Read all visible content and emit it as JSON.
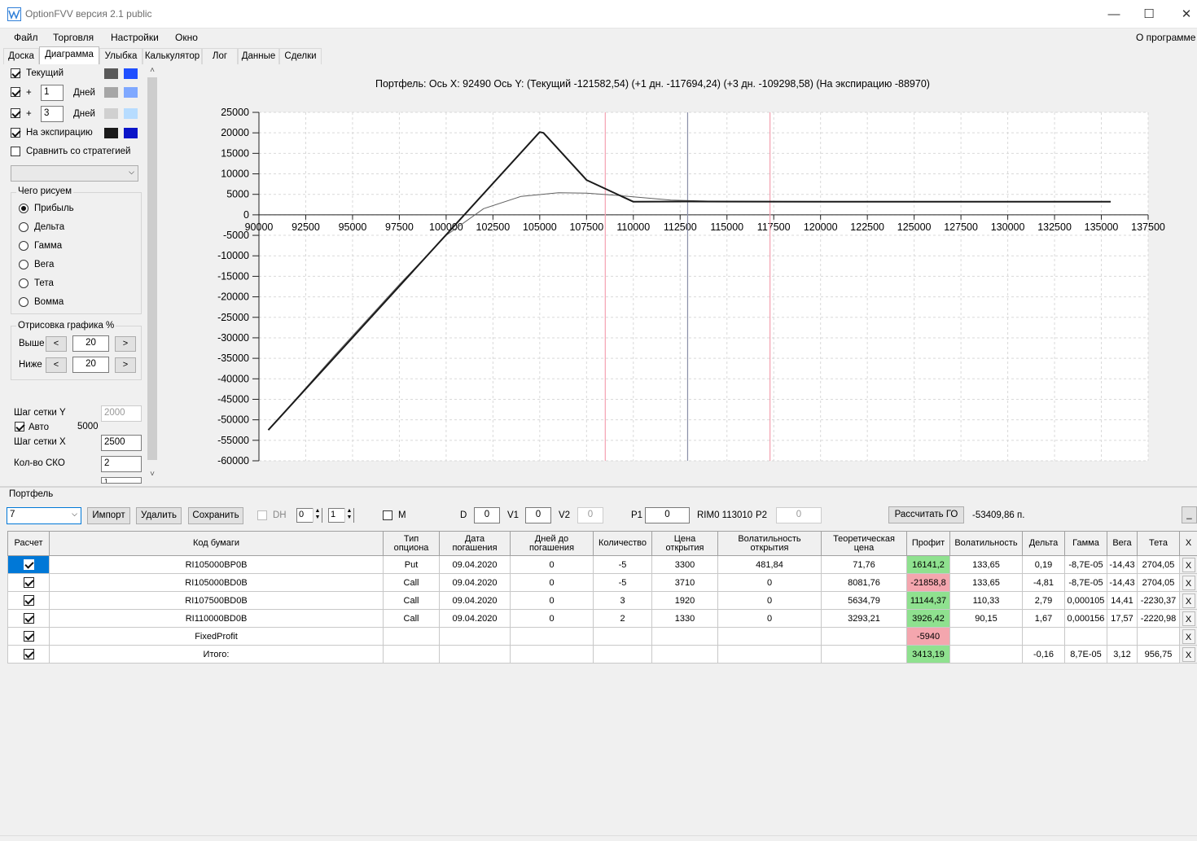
{
  "window": {
    "title": "OptionFVV версия 2.1 public",
    "min_label": "—",
    "max_label": "☐",
    "close_label": "✕"
  },
  "menu": {
    "items": [
      "Файл",
      "Торговля",
      "Настройки",
      "Окно"
    ],
    "about": "О программе"
  },
  "tabs": [
    "Доска",
    "Диаграмма",
    "Улыбка",
    "Калькулятор",
    "Лог",
    "Данные",
    "Сделки"
  ],
  "active_tab": "Диаграмма",
  "left": {
    "current_label": "Текущий",
    "plus_label": "+",
    "days_label": "Дней",
    "days1": "1",
    "days2": "3",
    "expiration_label": "На экспирацию",
    "compare_label": "Сравнить со стратегией",
    "strategy_select": "",
    "what_group": "Чего рисуем",
    "options": [
      "Прибыль",
      "Дельта",
      "Гамма",
      "Вега",
      "Тета",
      "Вомма"
    ],
    "draw_group": "Отрисовка графика %",
    "above_label": "Выше",
    "below_label": "Ниже",
    "above_value": "20",
    "below_value": "20",
    "lt": "<",
    "gt": ">",
    "grid_y_label": "Шаг сетки Y",
    "grid_y_value": "2000",
    "auto_label": "Авто",
    "auto_value": "5000",
    "grid_x_label": "Шаг сетки X",
    "grid_x_value": "2500",
    "sko_label": "Кол-во СКО",
    "sko_value": "2",
    "next_value": "1",
    "colors": {
      "current_a": "#595959",
      "current_b": "#1f4fff",
      "d1_a": "#a6a6a6",
      "d1_b": "#7fa8ff",
      "d3_a": "#d0d0d0",
      "d3_b": "#b7dcff",
      "exp_a": "#1a1a1a",
      "exp_b": "#0a14c8"
    }
  },
  "chart_header": "Портфель:  Ось  X:  92490  Ось  Y:   (Текущий  -121582,54)   (+1  дн.  -117694,24)   (+3  дн.  -109298,58)   (На  экспирацию  -88970)",
  "chart_data": {
    "type": "line",
    "xlim": [
      90000,
      137500
    ],
    "ylim": [
      -60000,
      25000
    ],
    "x_ticks": [
      90000,
      92500,
      95000,
      97500,
      100000,
      102500,
      105000,
      107500,
      110000,
      112500,
      115000,
      117500,
      120000,
      122500,
      125000,
      127500,
      130000,
      132500,
      135000,
      137500
    ],
    "y_ticks": [
      25000,
      20000,
      15000,
      10000,
      5000,
      0,
      -5000,
      -10000,
      -15000,
      -20000,
      -25000,
      -30000,
      -35000,
      -40000,
      -45000,
      -50000,
      -55000,
      -60000
    ],
    "grid": true,
    "vlines": [
      {
        "x": 108500,
        "color": "#f4a0b0"
      },
      {
        "x": 112900,
        "color": "#8a8fa8"
      },
      {
        "x": 117300,
        "color": "#f4a0b0"
      }
    ],
    "series": [
      {
        "color": "#1a1a1a",
        "width": 2,
        "x": [
          90500,
          105000,
          105200,
          107500,
          110000,
          113000,
          120000,
          135500
        ],
        "y": [
          -52500,
          20200,
          20000,
          8500,
          3200,
          3250,
          3200,
          3200
        ]
      },
      {
        "color": "#606060",
        "width": 1,
        "x": [
          90500,
          94000,
          97500,
          100000,
          102000,
          104000,
          106000,
          107500,
          109000,
          110500,
          112000,
          114000,
          118000,
          125000,
          135500
        ],
        "y": [
          -52500,
          -34500,
          -17000,
          -5000,
          1500,
          4500,
          5400,
          5300,
          4800,
          4200,
          3600,
          3350,
          3250,
          3200,
          3200
        ]
      }
    ]
  },
  "portfolio": {
    "label": "Портфель",
    "selector": "7",
    "import": "Импорт",
    "delete": "Удалить",
    "save": "Сохранить",
    "dh_label": "DH",
    "spin1": "0",
    "spin2": "1",
    "m_label": "M",
    "d_label": "D",
    "d_value": "0",
    "v1_label": "V1",
    "v1_value": "0",
    "v2_label": "V2",
    "v2_value": "0",
    "p1_label": "P1",
    "p1_value": "0",
    "rim_label": "RIM0 113010",
    "p2_label": "P2",
    "p2_value": "0",
    "calc_go": "Рассчитать ГО",
    "go_value": "-53409,86 п.",
    "minimize": "_"
  },
  "table": {
    "headers": [
      "Расчет",
      "Код бумаги",
      "Тип опциона",
      "Дата погашения",
      "Дней до погашения",
      "Количество",
      "Цена открытия",
      "Волатильность открытия",
      "Теоретическая цена",
      "Профит",
      "Волатильность",
      "Дельта",
      "Гамма",
      "Вега",
      "Тета",
      "X"
    ],
    "rows": [
      {
        "code": "RI105000BP0B",
        "type": "Put",
        "date": "09.04.2020",
        "days": "0",
        "qty": "-5",
        "price": "3300",
        "vol_open": "481,84",
        "theo": "71,76",
        "profit": "16141,2",
        "profit_state": "green",
        "vol": "133,65",
        "delta": "0,19",
        "gamma": "-8,7E-05",
        "vega": "-14,43",
        "theta": "2704,05",
        "selected": true
      },
      {
        "code": "RI105000BD0B",
        "type": "Call",
        "date": "09.04.2020",
        "days": "0",
        "qty": "-5",
        "price": "3710",
        "vol_open": "0",
        "theo": "8081,76",
        "profit": "-21858,8",
        "profit_state": "red",
        "vol": "133,65",
        "delta": "-4,81",
        "gamma": "-8,7E-05",
        "vega": "-14,43",
        "theta": "2704,05",
        "selected": false
      },
      {
        "code": "RI107500BD0B",
        "type": "Call",
        "date": "09.04.2020",
        "days": "0",
        "qty": "3",
        "price": "1920",
        "vol_open": "0",
        "theo": "5634,79",
        "profit": "11144,37",
        "profit_state": "green",
        "vol": "110,33",
        "delta": "2,79",
        "gamma": "0,000105",
        "vega": "14,41",
        "theta": "-2230,37",
        "selected": false
      },
      {
        "code": "RI110000BD0B",
        "type": "Call",
        "date": "09.04.2020",
        "days": "0",
        "qty": "2",
        "price": "1330",
        "vol_open": "0",
        "theo": "3293,21",
        "profit": "3926,42",
        "profit_state": "green",
        "vol": "90,15",
        "delta": "1,67",
        "gamma": "0,000156",
        "vega": "17,57",
        "theta": "-2220,98",
        "selected": false
      },
      {
        "code": "FixedProfit",
        "type": "",
        "date": "",
        "days": "",
        "qty": "",
        "price": "",
        "vol_open": "",
        "theo": "",
        "profit": "-5940",
        "profit_state": "red",
        "vol": "",
        "delta": "",
        "gamma": "",
        "vega": "",
        "theta": "",
        "selected": false
      },
      {
        "code": "Итого:",
        "type": "",
        "date": "",
        "days": "",
        "qty": "",
        "price": "",
        "vol_open": "",
        "theo": "",
        "profit": "3413,19",
        "profit_state": "green",
        "vol": "",
        "delta": "-0,16",
        "gamma": "8,7E-05",
        "vega": "3,12",
        "theta": "956,75",
        "selected": false
      }
    ],
    "x_label": "X"
  }
}
